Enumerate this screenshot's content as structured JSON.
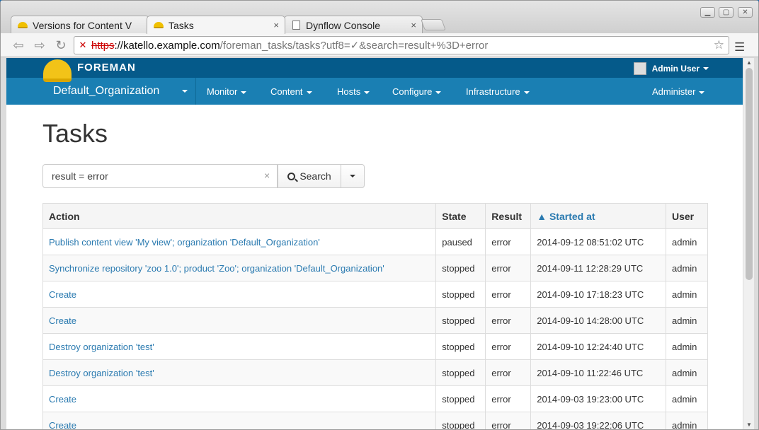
{
  "browser": {
    "tabs": [
      {
        "title": "Versions for Content V",
        "icon": "foreman-hat-icon",
        "close": "×"
      },
      {
        "title": "Tasks",
        "icon": "foreman-hat-icon",
        "close": "×"
      },
      {
        "title": "Dynflow Console",
        "icon": "document-icon",
        "close": "×"
      }
    ],
    "url": {
      "scheme": "https",
      "host": "://katello.example.com",
      "path": "/foreman_tasks/tasks?utf8=✓&search=result+%3D+error"
    }
  },
  "app": {
    "brand": "FOREMAN",
    "user": "Admin User",
    "org": "Default_Organization",
    "nav": [
      "Monitor",
      "Content",
      "Hosts",
      "Configure",
      "Infrastructure"
    ],
    "admin": "Administer"
  },
  "page": {
    "title": "Tasks",
    "search_value": "result = error",
    "search_button": "Search",
    "clear_glyph": "×"
  },
  "table": {
    "headers": [
      "Action",
      "State",
      "Result",
      "▲ Started at",
      "User"
    ],
    "rows": [
      {
        "action": "Publish content view 'My view'; organization 'Default_Organization'",
        "state": "paused",
        "result": "error",
        "started": "2014-09-12 08:51:02 UTC",
        "user": "admin"
      },
      {
        "action": "Synchronize repository 'zoo 1.0'; product 'Zoo'; organization 'Default_Organization'",
        "state": "stopped",
        "result": "error",
        "started": "2014-09-11 12:28:29 UTC",
        "user": "admin"
      },
      {
        "action": "Create",
        "state": "stopped",
        "result": "error",
        "started": "2014-09-10 17:18:23 UTC",
        "user": "admin"
      },
      {
        "action": "Create",
        "state": "stopped",
        "result": "error",
        "started": "2014-09-10 14:28:00 UTC",
        "user": "admin"
      },
      {
        "action": "Destroy organization 'test'",
        "state": "stopped",
        "result": "error",
        "started": "2014-09-10 12:24:40 UTC",
        "user": "admin"
      },
      {
        "action": "Destroy organization 'test'",
        "state": "stopped",
        "result": "error",
        "started": "2014-09-10 11:22:46 UTC",
        "user": "admin"
      },
      {
        "action": "Create",
        "state": "stopped",
        "result": "error",
        "started": "2014-09-03 19:23:00 UTC",
        "user": "admin"
      },
      {
        "action": "Create",
        "state": "stopped",
        "result": "error",
        "started": "2014-09-03 19:22:06 UTC",
        "user": "admin"
      }
    ]
  },
  "colors": {
    "topbar": "#055a8a",
    "navbar": "#1a7fb3",
    "link": "#2a7ab0"
  }
}
